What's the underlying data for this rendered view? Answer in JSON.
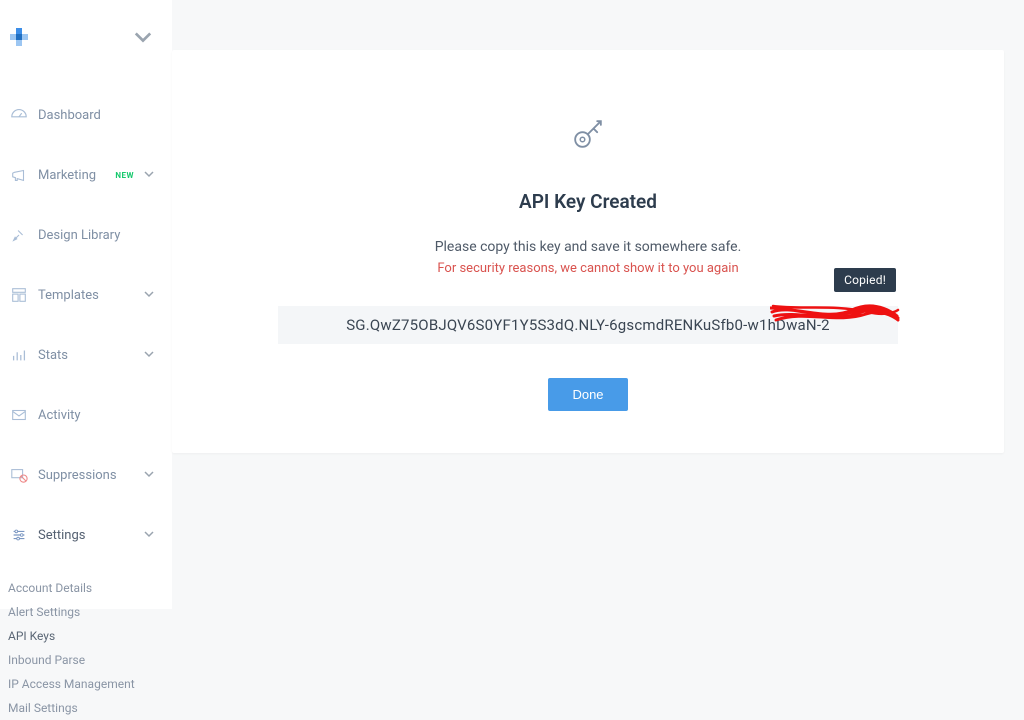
{
  "sidebar": {
    "items": [
      {
        "label": "Dashboard"
      },
      {
        "label": "Marketing",
        "badge": "NEW",
        "chevron": true
      },
      {
        "label": "Design Library"
      },
      {
        "label": "Templates",
        "chevron": true
      },
      {
        "label": "Stats",
        "chevron": true
      },
      {
        "label": "Activity"
      },
      {
        "label": "Suppressions",
        "chevron": true
      },
      {
        "label": "Settings",
        "chevron": true
      }
    ],
    "settings_sub": [
      "Account Details",
      "Alert Settings",
      "API Keys",
      "Inbound Parse",
      "IP Access Management",
      "Mail Settings"
    ]
  },
  "card": {
    "heading": "API Key Created",
    "instruction": "Please copy this key and save it somewhere safe.",
    "warning": "For security reasons, we cannot show it to you again",
    "api_key": "SG.QwZ75OBJQV6S0YF1Y5S3dQ.NLY-6gscmdRENKuSfb0-w1hDwaN-2",
    "tooltip": "Copied!",
    "done_label": "Done"
  }
}
